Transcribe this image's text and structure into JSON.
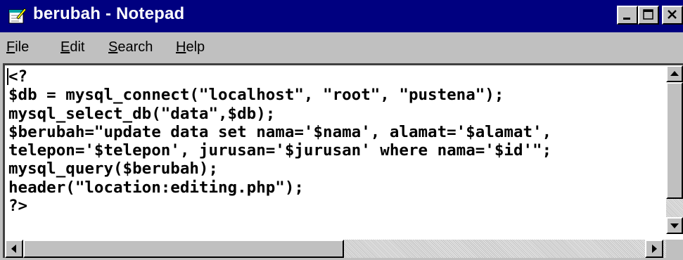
{
  "window": {
    "title": "berubah - Notepad"
  },
  "menu": [
    {
      "underline": "F",
      "rest": "ile"
    },
    {
      "underline": "E",
      "rest": "dit"
    },
    {
      "underline": "S",
      "rest": "earch"
    },
    {
      "underline": "H",
      "rest": "elp"
    }
  ],
  "editor": {
    "lines": [
      "<?",
      "$db = mysql_connect(\"localhost\", \"root\", \"pustena\");",
      "mysql_select_db(\"data\",$db);",
      "$berubah=\"update data set nama='$nama', alamat='$alamat',",
      "telepon='$telepon', jurusan='$jurusan' where nama='$id'\";",
      "mysql_query($berubah);",
      "header(\"location:editing.php\");",
      "?>"
    ]
  },
  "icons": {
    "app": "notepad-icon",
    "minimize": "minimize-icon",
    "maximize": "maximize-icon",
    "close": "close-icon"
  },
  "colors": {
    "titlebar": "#000080",
    "chrome": "#c0c0c0",
    "text": "#000000"
  }
}
